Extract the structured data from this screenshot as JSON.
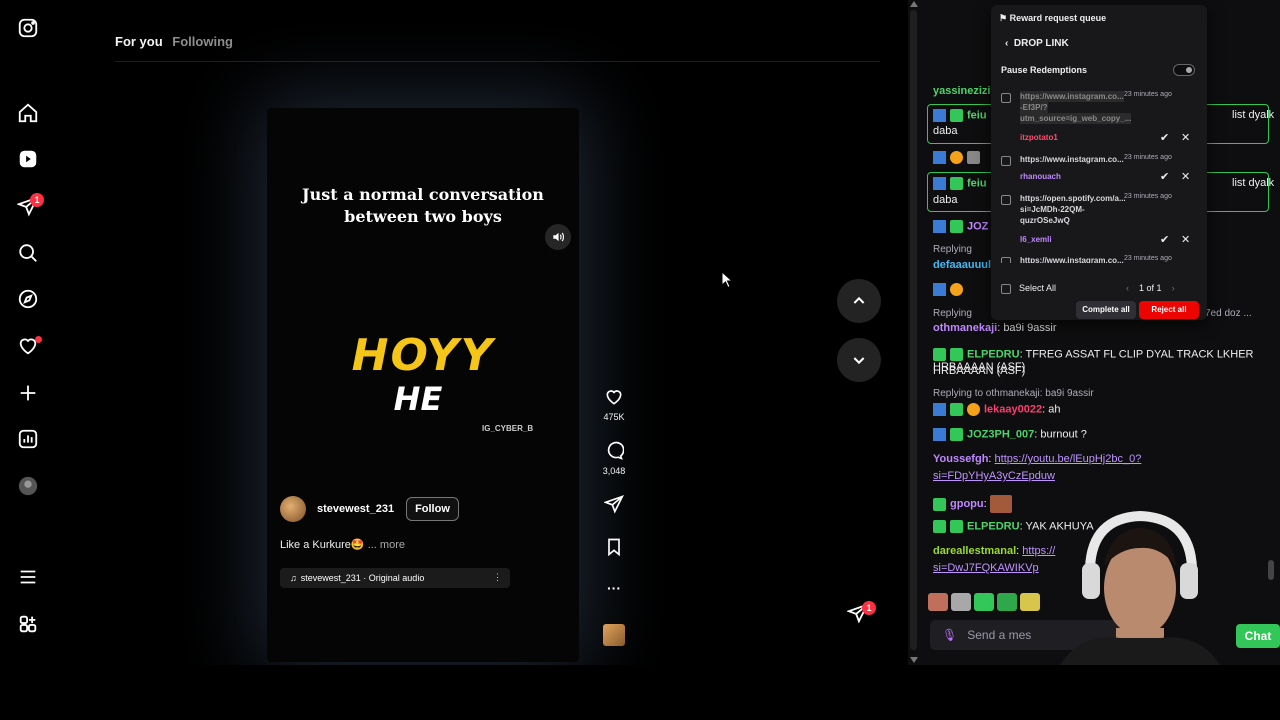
{
  "instagram": {
    "tabs": {
      "for_you": "For you",
      "following": "Following"
    },
    "nav_badge": "1",
    "reel": {
      "caption_line1": "Just a normal conversation",
      "caption_line2": "between two boys",
      "overlay_big": "HOYY",
      "overlay_small": "HE",
      "watermark": "IG_CYBER_B",
      "username": "stevewest_231",
      "follow_label": "Follow",
      "description": "Like a Kurkure🤩",
      "more": "... more",
      "audio": "stevewest_231 · Original audio",
      "audio_menu": "⋮"
    },
    "actions": {
      "likes": "475K",
      "comments": "3,048",
      "more": "···"
    },
    "message_badge": "1"
  },
  "twitch": {
    "reward_popup": {
      "title": "Reward request queue",
      "back_label": "DROP LINK",
      "pause_label": "Pause Redemptions",
      "items": [
        {
          "link": "https://www.instagram.co...",
          "link2": "-Ef3P/?",
          "link3": "utm_source=ig_web_copy_...",
          "time": "23 minutes ago",
          "user": "itzpotato1",
          "user_color": "#ff4d6d"
        },
        {
          "link": "https://www.instagram.co...",
          "link2": "",
          "link3": "",
          "time": "23 minutes ago",
          "user": "rhanouach",
          "user_color": "#c088ff"
        },
        {
          "link": "https://open.spotify.com/a...",
          "link2": "si=JcMDh-22QM-",
          "link3": "quzrOSeJwQ",
          "time": "23 minutes ago",
          "user": "l6_xemli",
          "user_color": "#c088ff"
        },
        {
          "link": "https://www.instagram.co...",
          "link2": "",
          "link3": "",
          "time": "23 minutes ago",
          "user": "",
          "user_color": "#c088ff"
        }
      ],
      "select_all": "Select All",
      "pager": "1 of 1",
      "complete_all": "Complete all",
      "reject_all": "Reject all"
    },
    "chat": [
      {
        "user": "yassinezizi",
        "text": ""
      },
      {
        "user": "feiu",
        "text": "daba"
      },
      {
        "user": "feiu",
        "text": "daba"
      },
      {
        "user": "JOZ",
        "text": ""
      },
      {
        "reply": "Replying",
        "user": "defaaauuul",
        "text": ""
      },
      {
        "reply": "Replying",
        "user": "othmanekaji",
        "text": "ba9i 9assir"
      },
      {
        "user": "ELPEDRU",
        "text": "TFREG ASSAT FL CLIP DYAL TRACK LKHER HRBAAAAN (ASF)"
      },
      {
        "reply": "Replying to othmanekaji: ba9i 9assir"
      },
      {
        "user": "lekaay0022",
        "text": "ah"
      },
      {
        "user": "JOZ3PH_007",
        "text": "burnout ?"
      },
      {
        "user": "Youssefgh",
        "link1": "https://youtu.be/lEupHj2bc_0?",
        "link2": "si=FDpYHyA3yCzEpduw"
      },
      {
        "user": "gpopu",
        "text": ""
      },
      {
        "user": "ELPEDRU",
        "text": "YAK AKHUYA"
      },
      {
        "user": "dareallestmanal",
        "link1": "https://",
        "link2": "si=DwJ7FQKAWIKVp"
      }
    ],
    "hl_text1": "list dyalk",
    "hl_text2": "list dyalk",
    "side_text": "7ed doz ...",
    "input_placeholder": "Send a mes",
    "chat_button": "Chat"
  }
}
